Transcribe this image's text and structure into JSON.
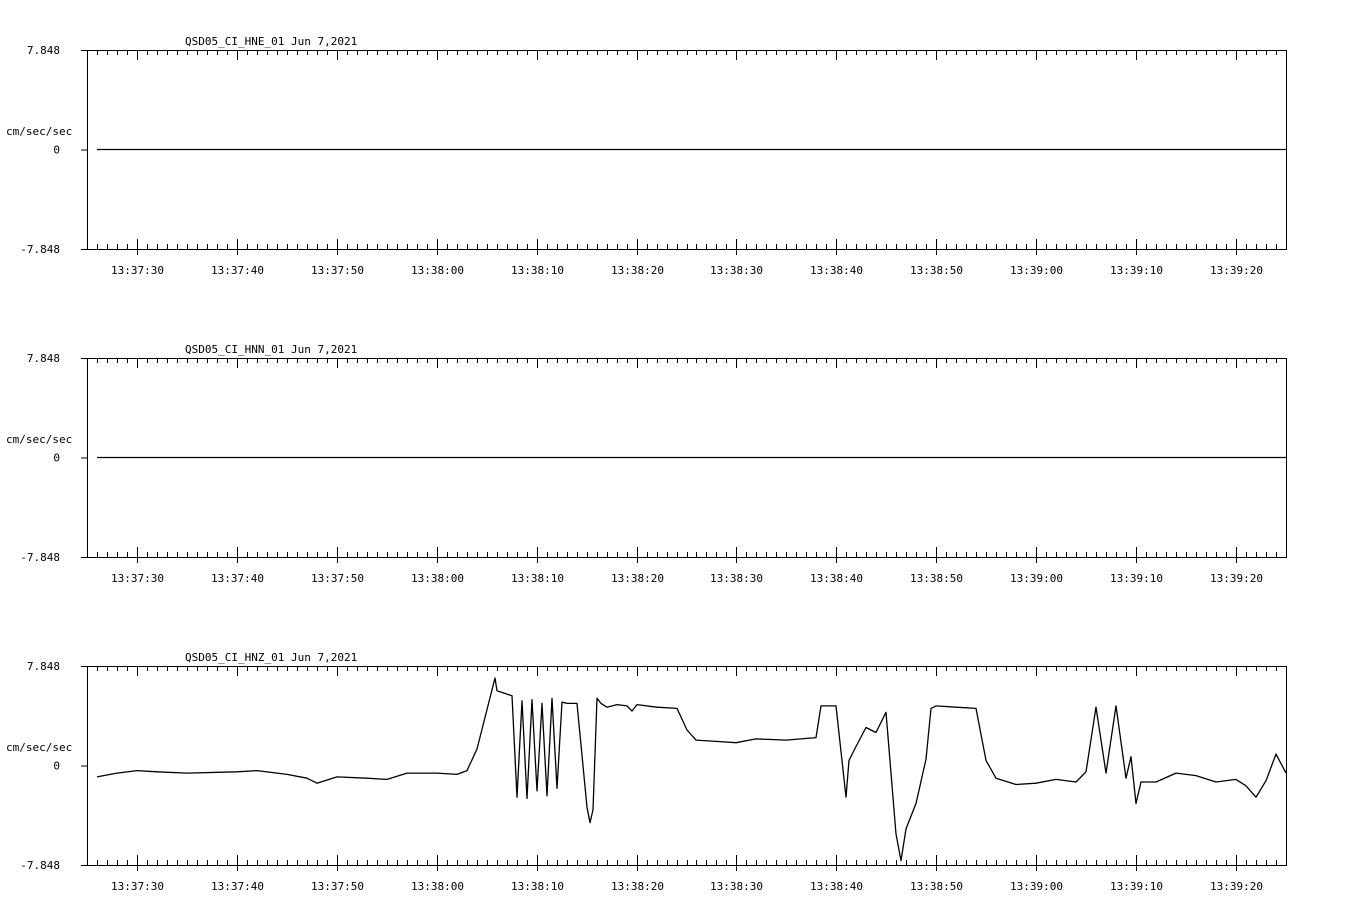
{
  "chart_data": [
    {
      "type": "line",
      "title": "QSD05_CI_HNE_01  Jun 7,2021",
      "ylabel": "cm/sec/sec",
      "ylim": [
        -7.848,
        7.848
      ],
      "yticks": [
        "7.848",
        "0",
        "-7.848"
      ],
      "xlim": [
        "13:37:25",
        "13:39:25"
      ],
      "xticks": [
        "13:37:30",
        "13:37:40",
        "13:37:50",
        "13:38:00",
        "13:38:10",
        "13:38:20",
        "13:38:30",
        "13:38:40",
        "13:38:50",
        "13:39:00",
        "13:39:10",
        "13:39:20"
      ],
      "grid": false,
      "series": [
        {
          "x": [
            "13:37:26",
            "13:39:25"
          ],
          "values": [
            0,
            0
          ]
        }
      ]
    },
    {
      "type": "line",
      "title": "QSD05_CI_HNN_01  Jun 7,2021",
      "ylabel": "cm/sec/sec",
      "ylim": [
        -7.848,
        7.848
      ],
      "yticks": [
        "7.848",
        "0",
        "-7.848"
      ],
      "xlim": [
        "13:37:25",
        "13:39:25"
      ],
      "xticks": [
        "13:37:30",
        "13:37:40",
        "13:37:50",
        "13:38:00",
        "13:38:10",
        "13:38:20",
        "13:38:30",
        "13:38:40",
        "13:38:50",
        "13:39:00",
        "13:39:10",
        "13:39:20"
      ],
      "grid": false,
      "series": [
        {
          "x": [
            "13:37:26",
            "13:39:25"
          ],
          "values": [
            0,
            0
          ]
        }
      ]
    },
    {
      "type": "line",
      "title": "QSD05_CI_HNZ_01  Jun 7,2021",
      "ylabel": "cm/sec/sec",
      "ylim": [
        -7.848,
        7.848
      ],
      "yticks": [
        "7.848",
        "0",
        "-7.848"
      ],
      "xlim": [
        "13:37:25",
        "13:39:25"
      ],
      "xticks": [
        "13:37:30",
        "13:37:40",
        "13:37:50",
        "13:38:00",
        "13:38:10",
        "13:38:20",
        "13:38:30",
        "13:38:40",
        "13:38:50",
        "13:39:00",
        "13:39:10",
        "13:39:20"
      ],
      "grid": false,
      "series": [
        {
          "x": [
            "13:37:26",
            "13:37:28",
            "13:37:30",
            "13:37:32",
            "13:37:35",
            "13:37:40",
            "13:37:42",
            "13:37:45",
            "13:37:47",
            "13:37:48",
            "13:37:50",
            "13:37:53",
            "13:37:55",
            "13:37:57",
            "13:38:00",
            "13:38:02",
            "13:38:03",
            "13:38:04",
            "13:38:05.8",
            "13:38:06",
            "13:38:07.5",
            "13:38:08",
            "13:38:08.5",
            "13:38:09",
            "13:38:09.5",
            "13:38:10",
            "13:38:10.5",
            "13:38:11",
            "13:38:11.5",
            "13:38:12",
            "13:38:12.5",
            "13:38:13",
            "13:38:14",
            "13:38:15",
            "13:38:15.3",
            "13:38:15.6",
            "13:38:16",
            "13:38:16.4",
            "13:38:17",
            "13:38:18",
            "13:38:19",
            "13:38:19.5",
            "13:38:20",
            "13:38:22",
            "13:38:24",
            "13:38:25",
            "13:38:26",
            "13:38:28",
            "13:38:30",
            "13:38:32",
            "13:38:35",
            "13:38:38",
            "13:38:38.5",
            "13:38:40",
            "13:38:41",
            "13:38:41.3",
            "13:38:42",
            "13:38:43",
            "13:38:44",
            "13:38:45",
            "13:38:46",
            "13:38:46.5",
            "13:38:47",
            "13:38:48",
            "13:38:49",
            "13:38:49.5",
            "13:38:50",
            "13:38:52",
            "13:38:54",
            "13:38:55",
            "13:38:56",
            "13:38:58",
            "13:39:00",
            "13:39:02",
            "13:39:04",
            "13:39:05",
            "13:39:06",
            "13:39:07",
            "13:39:08",
            "13:39:09",
            "13:39:09.5",
            "13:39:10",
            "13:39:10.5",
            "13:39:12",
            "13:39:14",
            "13:39:16",
            "13:39:18",
            "13:39:20",
            "13:39:21",
            "13:39:22",
            "13:39:23",
            "13:39:24",
            "13:39:25"
          ],
          "values": [
            -0.9,
            -0.6,
            -0.4,
            -0.5,
            -0.6,
            -0.5,
            -0.4,
            -0.7,
            -1.0,
            -1.4,
            -0.9,
            -1.0,
            -1.1,
            -0.6,
            -0.6,
            -0.7,
            -0.4,
            1.3,
            6.9,
            5.9,
            5.5,
            -2.5,
            5.1,
            -2.6,
            5.2,
            -2.0,
            4.9,
            -2.4,
            5.3,
            -1.8,
            5.0,
            4.9,
            4.9,
            -3.3,
            -4.5,
            -3.5,
            5.3,
            4.9,
            4.6,
            4.8,
            4.7,
            4.3,
            4.8,
            4.6,
            4.5,
            2.8,
            2.0,
            1.9,
            1.8,
            2.1,
            2.0,
            2.2,
            4.7,
            4.7,
            -2.5,
            0.4,
            1.5,
            3.0,
            2.6,
            4.2,
            -5.4,
            -7.5,
            -5.0,
            -3.0,
            0.5,
            4.5,
            4.7,
            4.6,
            4.5,
            0.4,
            -1.0,
            -1.5,
            -1.4,
            -1.1,
            -1.3,
            -0.5,
            4.6,
            -0.6,
            4.7,
            -1.0,
            0.7,
            -3.0,
            -1.3,
            -1.3,
            -0.6,
            -0.8,
            -1.3,
            -1.1,
            -1.6,
            -2.5,
            -1.2,
            0.9,
            -0.6
          ]
        }
      ]
    }
  ]
}
